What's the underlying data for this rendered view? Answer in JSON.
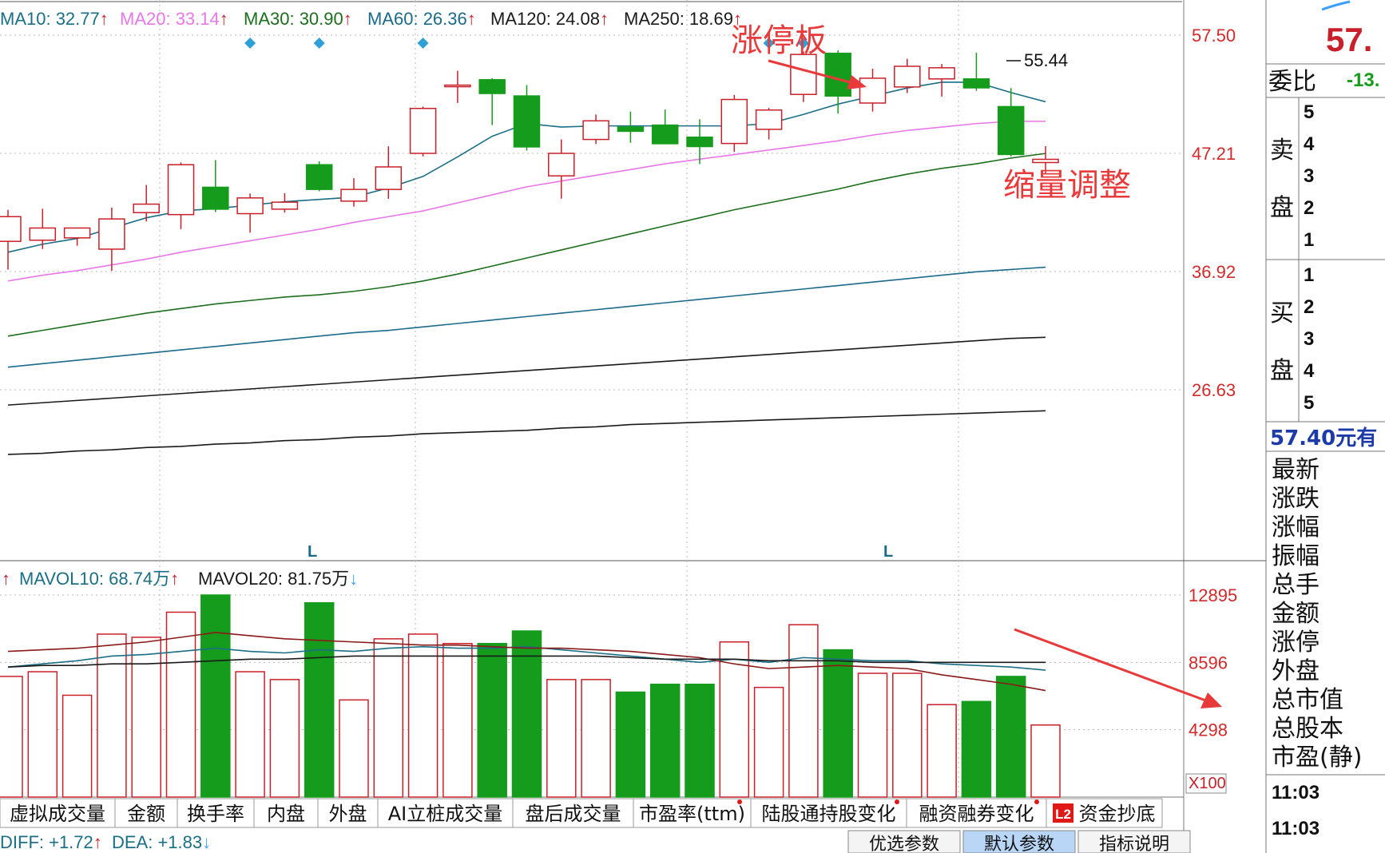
{
  "ma_bar": {
    "ma10": {
      "label": "MA10: 32.77",
      "color": "#1a6f86"
    },
    "ma20": {
      "label": "MA20: 33.14",
      "color": "#e878e8"
    },
    "ma30": {
      "label": "MA30: 30.90",
      "color": "#1d6e1d"
    },
    "ma60": {
      "label": "MA60: 26.36",
      "color": "#1c6a8a"
    },
    "ma120": {
      "label": "MA120: 24.08",
      "color": "#1a1a1a"
    },
    "ma250": {
      "label": "MA250: 18.69",
      "color": "#1a1a1a"
    },
    "up_arrow": "↑"
  },
  "vol_bar": {
    "mavol10": "MAVOL10: 68.74万",
    "mavol20": "MAVOL20: 81.75万",
    "up_arrow": "↑",
    "down_arrow": "↓"
  },
  "macd_bar": {
    "diff": "DIFF: +1.72",
    "dea": "DEA: +1.83",
    "up_arrow": "↑",
    "down_arrow": "↓"
  },
  "price_axis": [
    "57.50",
    "47.21",
    "36.92",
    "26.63"
  ],
  "vol_axis": [
    "12895",
    "8596",
    "4298"
  ],
  "vol_unit": "X100",
  "annotations": {
    "limit_up": "涨停板",
    "shrink": "缩量调整",
    "high_price": "55.44",
    "l_marker": "L"
  },
  "tabs": [
    "虚拟成交量",
    "金额",
    "换手率",
    "内盘",
    "外盘",
    "AI立桩成交量",
    "盘后成交量",
    "市盈率(ttm)",
    "陆股通持股变化",
    "融资融券变化",
    "资金抄底"
  ],
  "l2_badge": "L2",
  "param_buttons": [
    "优选参数",
    "默认参数",
    "指标说明"
  ],
  "right_panel": {
    "price_top": "57.",
    "weibi_label": "委比",
    "weibi_value": "-13.",
    "sell_label": [
      "卖",
      "盘"
    ],
    "buy_label": [
      "买",
      "盘"
    ],
    "levels_sell": [
      "5",
      "4",
      "3",
      "2",
      "1"
    ],
    "levels_buy": [
      "1",
      "2",
      "3",
      "4",
      "5"
    ],
    "price_line": "57.40元有",
    "fields": [
      "最新",
      "涨跌",
      "涨幅",
      "振幅",
      "总手",
      "金额",
      "涨停",
      "外盘",
      "总市值",
      "总股本",
      "市盈(静)"
    ],
    "times": [
      "11:03",
      "11:03"
    ]
  },
  "colors": {
    "up": "#c8202a",
    "down": "#169c1c",
    "axis_text": "#d22a2a",
    "annot": "#e83a3a",
    "grid": "#b8b8b8"
  },
  "chart_data": {
    "type": "candlestick",
    "y_axis_ticks": [
      57.5,
      47.21,
      36.92,
      26.63
    ],
    "ylim": [
      19.1,
      60.2
    ],
    "candles": [
      {
        "o": 39.55,
        "h": 42.29,
        "l": 37.09,
        "c": 41.7
      },
      {
        "o": 39.65,
        "h": 42.39,
        "l": 38.88,
        "c": 40.71
      },
      {
        "o": 39.85,
        "h": 40.13,
        "l": 39.17,
        "c": 40.71
      },
      {
        "o": 38.87,
        "h": 42.49,
        "l": 36.99,
        "c": 41.5
      },
      {
        "o": 42.05,
        "h": 44.46,
        "l": 41.28,
        "c": 42.79
      },
      {
        "o": 41.88,
        "h": 46.42,
        "l": 40.61,
        "c": 46.22
      },
      {
        "o": 44.26,
        "h": 46.62,
        "l": 42.1,
        "c": 42.35
      },
      {
        "o": 41.96,
        "h": 43.71,
        "l": 40.31,
        "c": 43.33
      },
      {
        "o": 42.35,
        "h": 43.74,
        "l": 42.05,
        "c": 42.96
      },
      {
        "o": 46.22,
        "h": 46.52,
        "l": 43.91,
        "c": 44.07
      },
      {
        "o": 43.05,
        "h": 45.05,
        "l": 42.57,
        "c": 44.07
      },
      {
        "o": 44.07,
        "h": 47.82,
        "l": 43.25,
        "c": 46.03
      },
      {
        "o": 47.21,
        "h": 51.28,
        "l": 46.94,
        "c": 51.12
      },
      {
        "o": 53.15,
        "h": 54.4,
        "l": 51.6,
        "c": 53.15
      },
      {
        "o": 53.62,
        "h": 53.75,
        "l": 49.67,
        "c": 52.42
      },
      {
        "o": 52.21,
        "h": 53.15,
        "l": 47.45,
        "c": 47.77
      },
      {
        "o": 45.25,
        "h": 48.42,
        "l": 43.27,
        "c": 47.21
      },
      {
        "o": 48.42,
        "h": 50.59,
        "l": 48.02,
        "c": 50.04
      },
      {
        "o": 49.5,
        "h": 50.85,
        "l": 48.13,
        "c": 49.13
      },
      {
        "o": 49.67,
        "h": 51.02,
        "l": 48.15,
        "c": 48.05
      },
      {
        "o": 48.62,
        "h": 50.18,
        "l": 46.28,
        "c": 47.8
      },
      {
        "o": 48.07,
        "h": 52.3,
        "l": 47.35,
        "c": 51.9
      },
      {
        "o": 49.3,
        "h": 51.17,
        "l": 48.42,
        "c": 50.98
      },
      {
        "o": 52.34,
        "h": 56.07,
        "l": 51.68,
        "c": 55.82
      },
      {
        "o": 55.92,
        "h": 56.17,
        "l": 50.68,
        "c": 52.2
      },
      {
        "o": 51.59,
        "h": 54.58,
        "l": 50.85,
        "c": 53.75
      },
      {
        "o": 52.99,
        "h": 55.44,
        "l": 52.46,
        "c": 54.79
      },
      {
        "o": 53.69,
        "h": 54.99,
        "l": 52.15,
        "c": 54.66
      },
      {
        "o": 53.69,
        "h": 55.97,
        "l": 52.65,
        "c": 52.91
      },
      {
        "o": 51.28,
        "h": 52.89,
        "l": 46.94,
        "c": 47.11
      },
      {
        "o": 46.41,
        "h": 47.84,
        "l": 45.45,
        "c": 46.69
      }
    ],
    "ma_lines": [
      {
        "name": "MA10",
        "values": [
          38.6,
          39.3,
          39.8,
          40.7,
          41.6,
          42.2,
          42.4,
          42.7,
          43.0,
          43.2,
          43.4,
          44.2,
          45.2,
          46.9,
          48.7,
          49.8,
          49.5,
          49.6,
          49.6,
          49.6,
          49.6,
          49.6,
          49.8,
          50.6,
          51.5,
          52.2,
          52.9,
          53.4,
          53.4,
          52.5,
          51.7
        ]
      },
      {
        "name": "MA20",
        "values": [
          36.1,
          36.6,
          37.0,
          37.5,
          38.0,
          38.6,
          39.1,
          39.6,
          40.1,
          40.6,
          41.2,
          41.7,
          42.2,
          42.9,
          43.6,
          44.3,
          44.8,
          45.3,
          45.8,
          46.3,
          46.7,
          47.1,
          47.5,
          47.9,
          48.3,
          48.8,
          49.2,
          49.5,
          49.8,
          50.0,
          50.0
        ]
      },
      {
        "name": "MA30",
        "values": [
          31.3,
          31.8,
          32.3,
          32.8,
          33.3,
          33.7,
          34.1,
          34.4,
          34.7,
          34.9,
          35.2,
          35.6,
          36.1,
          36.7,
          37.4,
          38.1,
          38.8,
          39.5,
          40.2,
          40.9,
          41.6,
          42.3,
          42.9,
          43.5,
          44.1,
          44.8,
          45.4,
          45.9,
          46.3,
          46.8,
          47.2
        ]
      },
      {
        "name": "MA60",
        "values": [
          28.6,
          28.9,
          29.2,
          29.5,
          29.8,
          30.1,
          30.4,
          30.7,
          31.0,
          31.3,
          31.6,
          31.8,
          32.1,
          32.4,
          32.7,
          33.0,
          33.3,
          33.6,
          33.9,
          34.2,
          34.5,
          34.8,
          35.1,
          35.4,
          35.7,
          36.0,
          36.3,
          36.6,
          36.9,
          37.1,
          37.3
        ]
      },
      {
        "name": "MA120",
        "values": [
          25.3,
          25.5,
          25.7,
          25.9,
          26.1,
          26.3,
          26.5,
          26.7,
          26.9,
          27.1,
          27.3,
          27.5,
          27.7,
          27.9,
          28.1,
          28.3,
          28.5,
          28.7,
          28.9,
          29.1,
          29.3,
          29.5,
          29.7,
          29.9,
          30.1,
          30.3,
          30.5,
          30.7,
          30.9,
          31.1,
          31.2
        ]
      },
      {
        "name": "MA250",
        "values": [
          21.0,
          21.1,
          21.3,
          21.4,
          21.6,
          21.7,
          21.9,
          22.0,
          22.2,
          22.3,
          22.5,
          22.6,
          22.8,
          22.9,
          23.0,
          23.1,
          23.3,
          23.4,
          23.6,
          23.7,
          23.8,
          23.9,
          24.0,
          24.1,
          24.2,
          24.3,
          24.4,
          24.5,
          24.6,
          24.7,
          24.8
        ]
      }
    ],
    "volume": {
      "ticks": [
        12895,
        8596,
        4298
      ],
      "ylim": [
        0,
        12895
      ],
      "values": [
        7700,
        8000,
        6500,
        10400,
        10200,
        11800,
        12895,
        8000,
        7500,
        12400,
        6200,
        10100,
        10400,
        9800,
        9800,
        10600,
        7500,
        7500,
        6700,
        7200,
        7200,
        9900,
        7000,
        11000,
        9400,
        7900,
        7900,
        5900,
        6100,
        7700,
        4600
      ],
      "mavol10": [
        8300,
        8500,
        8700,
        9000,
        9100,
        9300,
        9500,
        9300,
        9200,
        9400,
        9300,
        9500,
        9600,
        9500,
        9500,
        9600,
        9400,
        9200,
        9000,
        8800,
        8600,
        8800,
        8600,
        8900,
        8800,
        8700,
        8700,
        8500,
        8400,
        8300,
        8100
      ],
      "mavol20": [
        9300,
        9400,
        9500,
        9700,
        9900,
        10200,
        10500,
        10300,
        10100,
        10000,
        9900,
        9800,
        9700,
        9700,
        9600,
        9500,
        9500,
        9400,
        9300,
        9100,
        8900,
        8500,
        8200,
        8300,
        8400,
        8300,
        8200,
        7800,
        7500,
        7200,
        6800
      ],
      "ma_long": [
        8300,
        8400,
        8400,
        8500,
        8500,
        8600,
        8700,
        8800,
        8800,
        8900,
        9000,
        9000,
        9000,
        9000,
        9000,
        9000,
        9000,
        9000,
        8900,
        8800,
        8800,
        8800,
        8700,
        8700,
        8700,
        8600,
        8600,
        8600,
        8600,
        8600,
        8600
      ]
    }
  }
}
